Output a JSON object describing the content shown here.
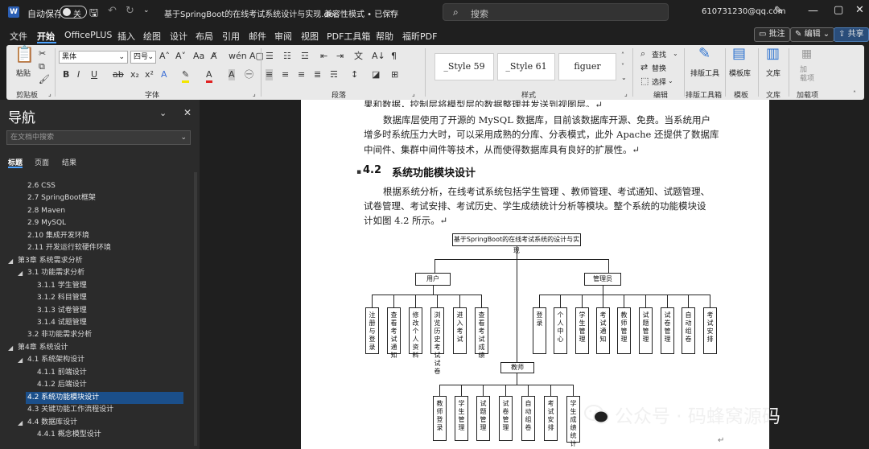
{
  "titlebar": {
    "autosave_label": "自动保存",
    "autosave_state": "关",
    "doc_title": "基于SpringBoot的在线考试系统设计与实现.doc",
    "compat_mode": "兼容性模式 • 已保存",
    "search_placeholder": "搜索",
    "account": "610731230@qq.com"
  },
  "menu": {
    "tabs": [
      "文件",
      "开始",
      "OfficePLUS",
      "插入",
      "绘图",
      "设计",
      "布局",
      "引用",
      "邮件",
      "审阅",
      "视图",
      "PDF工具箱",
      "帮助",
      "福昕PDF"
    ],
    "comment": "批注",
    "edit": "编辑",
    "share": "共享"
  },
  "ribbon": {
    "paste": "粘贴",
    "clipboard": "剪贴板",
    "font_name": "黑体",
    "font_size": "四号",
    "font": "字体",
    "paragraph": "段落",
    "styles": [
      "_Style 59",
      "_Style 61",
      "figuer"
    ],
    "style_group": "样式",
    "find": "查找",
    "replace": "替换",
    "select": "选择",
    "editing": "编辑",
    "typeset": "排版工具",
    "typeset_group": "排版工具箱",
    "template": "模板库",
    "template_group": "模板",
    "library": "文库",
    "library_group": "文库",
    "addin": "加\n载项",
    "addin_group": "加载项"
  },
  "nav": {
    "title": "导航",
    "search_placeholder": "在文档中搜索",
    "tabs": [
      "标题",
      "页面",
      "结果"
    ],
    "items": [
      {
        "label": "2.6  CSS",
        "level": 2
      },
      {
        "label": "2.7 SpringBoot框架",
        "level": 2
      },
      {
        "label": "2.8  Maven",
        "level": 2
      },
      {
        "label": "2.9  MySQL",
        "level": 2
      },
      {
        "label": "2.10  集成开发环境",
        "level": 2
      },
      {
        "label": "2.11  开发运行软硬件环境",
        "level": 2
      },
      {
        "label": "第3章 系统需求分析",
        "level": 1
      },
      {
        "label": "3.1  功能需求分析",
        "level": 2
      },
      {
        "label": "3.1.1  学生管理",
        "level": 3
      },
      {
        "label": "3.1.2  科目管理",
        "level": 3
      },
      {
        "label": "3.1.3  试卷管理",
        "level": 3
      },
      {
        "label": "3.1.4  试题管理",
        "level": 3
      },
      {
        "label": "3.2  非功能需求分析",
        "level": 2
      },
      {
        "label": "第4章 系统设计",
        "level": 1
      },
      {
        "label": "4.1  系统架构设计",
        "level": 2
      },
      {
        "label": "4.1.1  前端设计",
        "level": 3
      },
      {
        "label": "4.1.2  后端设计",
        "level": 3
      },
      {
        "label": "4.2  系统功能模块设计",
        "level": 2
      },
      {
        "label": "4.3  关键功能工作流程设计",
        "level": 2
      },
      {
        "label": "4.4  数据库设计",
        "level": 2
      },
      {
        "label": "4.4.1  概念模型设计",
        "level": 3
      }
    ]
  },
  "doc": {
    "line0": "果和数据，控制层将模型层的数据整理并发送到视图层。↵",
    "para1_line1": "数据库层使用了开源的 MySQL 数据库，目前该数据库开源、免费。当系统用户",
    "para1_line2": "增多时系统压力大时，可以采用成熟的分库、分表模式，此外 Apache 还提供了数据库",
    "para1_line3": "中间件、集群中间件等技术，从而使得数据库具有良好的扩展性。↵",
    "heading_num": "4.2",
    "heading_text": "系统功能模块设计",
    "para2_line1": "根据系统分析，在线考试系统包括学生管理 、教师管理、考试通知、试题管理、",
    "para2_line2": "试卷管理、考试安排、考试历史、学生成绩统计分析等模块。整个系统的功能模块设",
    "para2_line3": "计如图 4.2 所示。↵",
    "diagram": {
      "root": "基于SpringBoot的在线考试系统的设计与实现",
      "user": "用户",
      "admin": "管理员",
      "teacher": "教师",
      "user_children": [
        "注册与登录",
        "查看考试通知",
        "修改个人资料",
        "浏览历史考试试卷",
        "进入考试",
        "查看考试成绩"
      ],
      "admin_children": [
        "登录",
        "个人中心",
        "学生管理",
        "考试通知",
        "教师管理",
        "试题管理",
        "试卷管理",
        "自动组卷",
        "考试安排"
      ],
      "teacher_children": [
        "教师登录",
        "学生管理",
        "试题管理",
        "试卷管理",
        "自动组卷",
        "考试安排",
        "学生成绩统计"
      ]
    },
    "return_mark": "↵"
  },
  "watermark": "公众号 · 码蜂窝源码"
}
